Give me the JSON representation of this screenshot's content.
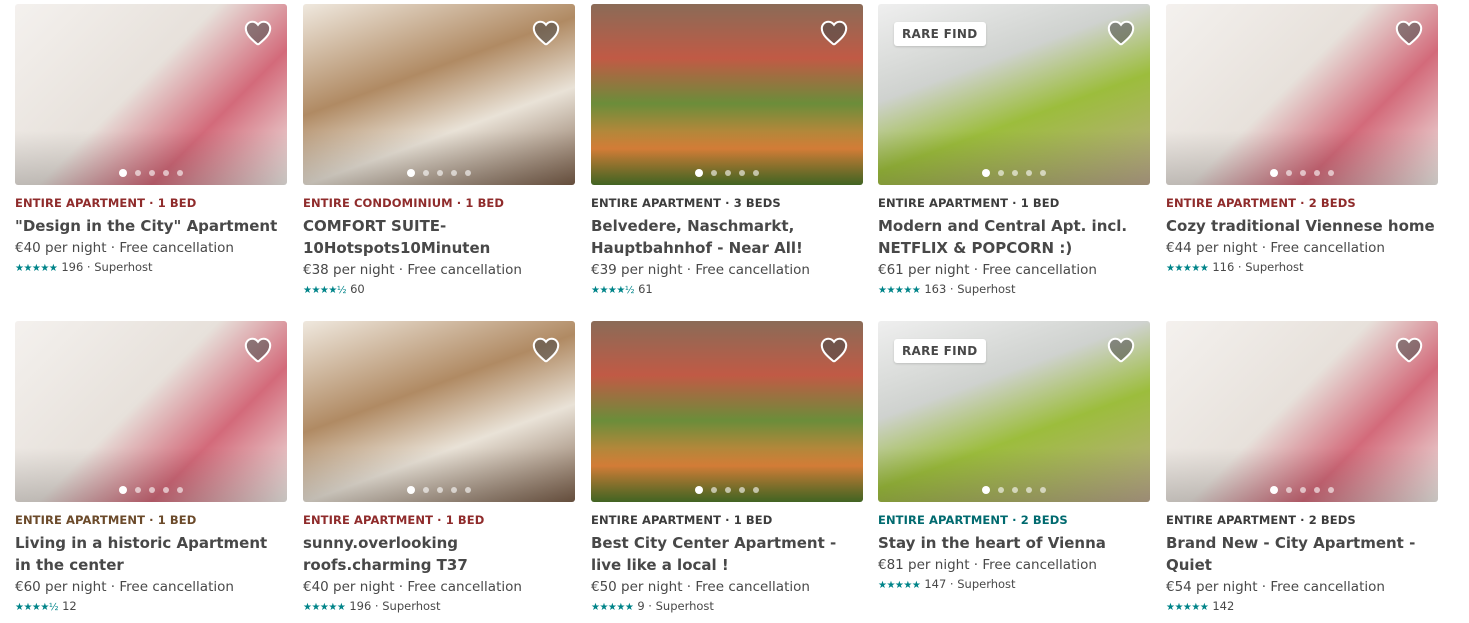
{
  "colors": {
    "kicker_brown": "#8f2b2b",
    "kicker_teal": "#006a6f",
    "star_teal": "#008489"
  },
  "listings": [
    {
      "kicker": "ENTIRE APARTMENT · 1 BED",
      "kicker_color": "#8f2b2b",
      "title": "\"Design in the City\" Apartment",
      "price": "€40 per night · Free cancellation",
      "stars": "★★★★★",
      "review_count": "196",
      "host": " · Superhost",
      "badge": "",
      "photo_index": 0
    },
    {
      "kicker": "ENTIRE CONDOMINIUM · 1 BED",
      "kicker_color": "#8f2b2b",
      "title": "COMFORT SUITE-10Hotspots10Minuten",
      "price": "€38 per night · Free cancellation",
      "stars": "★★★★½",
      "review_count": "60",
      "host": "",
      "badge": "",
      "photo_index": 1
    },
    {
      "kicker": "ENTIRE APARTMENT · 3 BEDS",
      "kicker_color": "#3c3c3c",
      "title": "Belvedere, Naschmarkt, Hauptbahnhof - Near All!",
      "price": "€39 per night · Free cancellation",
      "stars": "★★★★½",
      "review_count": "61",
      "host": "",
      "badge": "",
      "photo_index": 2
    },
    {
      "kicker": "ENTIRE APARTMENT · 1 BED",
      "kicker_color": "#3c3c3c",
      "title": "Modern and Central Apt. incl. NETFLIX & POPCORN :)",
      "price": "€61 per night · Free cancellation",
      "stars": "★★★★★",
      "review_count": "163",
      "host": " · Superhost",
      "badge": "RARE FIND",
      "photo_index": 3
    },
    {
      "kicker": "ENTIRE APARTMENT · 2 BEDS",
      "kicker_color": "#8f2b2b",
      "title": "Cozy traditional Viennese home",
      "price": "€44 per night · Free cancellation",
      "stars": "★★★★★",
      "review_count": "116",
      "host": " · Superhost",
      "badge": "",
      "photo_index": 0
    },
    {
      "kicker": "ENTIRE APARTMENT · 1 BED",
      "kicker_color": "#6b4a2a",
      "title": "Living in a historic Apartment in the center",
      "price": "€60 per night · Free cancellation",
      "stars": "★★★★½",
      "review_count": "12",
      "host": "",
      "badge": "",
      "photo_index": 0
    },
    {
      "kicker": "ENTIRE APARTMENT · 1 BED",
      "kicker_color": "#8f2b2b",
      "title": "sunny.overlooking roofs.charming T37",
      "price": "€40 per night · Free cancellation",
      "stars": "★★★★★",
      "review_count": "196",
      "host": " · Superhost",
      "badge": "",
      "photo_index": 1
    },
    {
      "kicker": "ENTIRE APARTMENT · 1 BED",
      "kicker_color": "#3c3c3c",
      "title": "Best City Center Apartment - live like a local !",
      "price": "€50 per night · Free cancellation",
      "stars": "★★★★★",
      "review_count": "9",
      "host": " · Superhost",
      "badge": "",
      "photo_index": 2
    },
    {
      "kicker": "ENTIRE APARTMENT · 2 BEDS",
      "kicker_color": "#006a6f",
      "title": "Stay in the heart of Vienna",
      "price": "€81 per night · Free cancellation",
      "stars": "★★★★★",
      "review_count": "147",
      "host": " · Superhost",
      "badge": "RARE FIND",
      "photo_index": 3
    },
    {
      "kicker": "ENTIRE APARTMENT · 2 BEDS",
      "kicker_color": "#3c3c3c",
      "title": "Brand New - City Apartment - Quiet",
      "price": "€54 per night · Free cancellation",
      "stars": "★★★★★",
      "review_count": "142",
      "host": "",
      "badge": "",
      "photo_index": 0
    }
  ]
}
